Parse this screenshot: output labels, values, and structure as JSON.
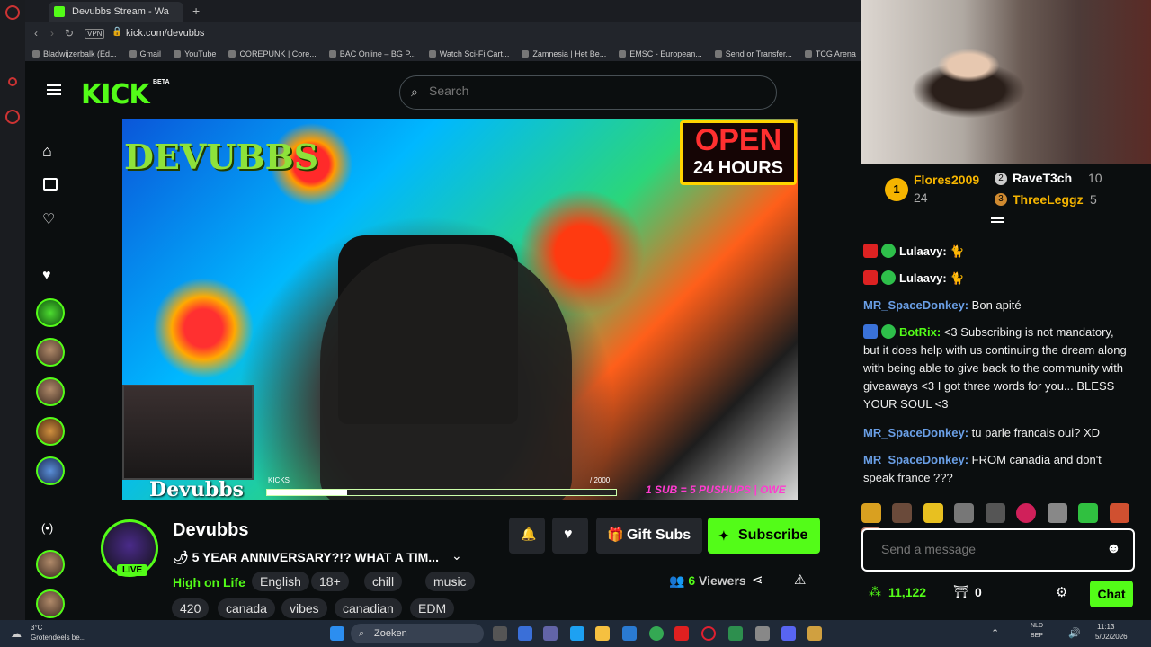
{
  "browser": {
    "tab_title": "Devubbs Stream - Wa",
    "new_tab": "+",
    "url": "kick.com/devubbs",
    "vpn": "VPN",
    "bookmarks": [
      "Bladwijzerbalk (Ed...",
      "Gmail",
      "YouTube",
      "COREPUNK | Core...",
      "BAC Online – BG P...",
      "Watch Sci-Fi Cart...",
      "Zamnesia | Het Be...",
      "EMSC - European...",
      "Send or Transfer...",
      "TCG Arena"
    ]
  },
  "header": {
    "logo": "KICK",
    "beta": "BETA",
    "search_placeholder": "Search"
  },
  "video": {
    "overlay_logo": "DEVUBBS",
    "open_sign_line1": "OPEN",
    "open_sign_line2": "24 HOURS",
    "name_text": "Devubbs",
    "kicks_label": "KICKS",
    "goal_text": "/ 2000",
    "pushup_text": "1 SUB = 5 PUSHUPS | OWE",
    "goal_progress": 0.23
  },
  "channel": {
    "name": "Devubbs",
    "live": "LIVE",
    "title": "🌶 5 YEAR ANNIVERSARY?!? WHAT A TIM...",
    "game": "High on Life",
    "tags": [
      "English",
      "18+",
      "chill",
      "music",
      "420",
      "canada",
      "vibes",
      "canadian",
      "EDM"
    ],
    "gift_subs": "Gift Subs",
    "subscribe": "Subscribe",
    "viewers_count": "6",
    "viewers_label": "Viewers"
  },
  "leaderboard": {
    "first": {
      "rank": "1",
      "name": "Flores2009",
      "count": "24"
    },
    "second": {
      "rank": "2",
      "name": "RaveT3ch",
      "count": "10"
    },
    "third": {
      "rank": "3",
      "name": "ThreeLeggz",
      "count": "5"
    }
  },
  "chat": {
    "messages": [
      {
        "user": "Lulaavy:",
        "text": "🐈"
      },
      {
        "user": "Lulaavy:",
        "text": "🐈"
      },
      {
        "user": "MR_SpaceDonkey:",
        "text": "Bon apité"
      },
      {
        "user": "BotRix:",
        "text": "<3 Subscribing is not mandatory, but it does help with us continuing the dream along with being able to give back to the community with giveaways <3 I got three words for you... BLESS YOUR SOUL <3"
      },
      {
        "user": "MR_SpaceDonkey:",
        "text": "tu parle francais oui? XD"
      },
      {
        "user": "MR_SpaceDonkey:",
        "text": "FROM canadia and don't speak france ???"
      }
    ],
    "input_placeholder": "Send a message",
    "points": "11,122",
    "drops": "0",
    "chat_button": "Chat"
  },
  "taskbar": {
    "weather_temp": "3°C",
    "weather_text": "Grotendeels be...",
    "search": "Zoeken",
    "lang1": "NLD",
    "lang2": "BEP",
    "time": "11:13",
    "date": "5/02/2026"
  },
  "colors": {
    "accent": "#53fc18",
    "bg": "#0b0e0f",
    "chip": "#24272c",
    "chat_name_blue": "#6a9fe6",
    "chat_name_green": "#53fc18",
    "chat_name_white": "#ffffff"
  }
}
